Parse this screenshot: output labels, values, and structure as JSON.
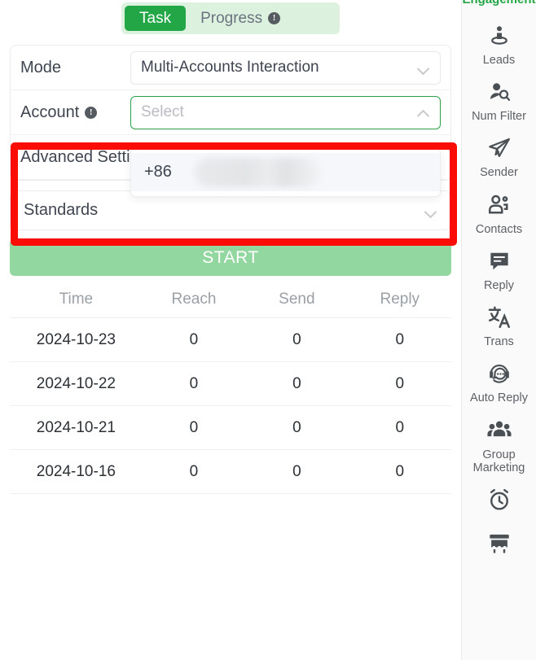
{
  "tabs": [
    {
      "label": "Task",
      "active": true,
      "badge": ""
    },
    {
      "label": "Progress",
      "active": false,
      "badge": "!"
    }
  ],
  "form": {
    "mode": {
      "label": "Mode",
      "value": "Multi-Accounts Interaction",
      "chevron": "chevron-down"
    },
    "account": {
      "label": "Account",
      "badge": "!",
      "placeholder": "Select",
      "chevron": "chevron-up",
      "options": [
        {
          "prefix": "+86",
          "masked": true
        }
      ]
    },
    "advanced": {
      "label": "Advanced Settings"
    }
  },
  "standards": {
    "value": "Standards",
    "chevron": "chevron-down"
  },
  "start_button": {
    "label": "START"
  },
  "table": {
    "columns": [
      "Time",
      "Reach",
      "Send",
      "Reply"
    ],
    "rows": [
      {
        "time": "2024-10-23",
        "reach": "0",
        "send": "0",
        "reply": "0"
      },
      {
        "time": "2024-10-22",
        "reach": "0",
        "send": "0",
        "reply": "0"
      },
      {
        "time": "2024-10-21",
        "reach": "0",
        "send": "0",
        "reply": "0"
      },
      {
        "time": "2024-10-16",
        "reach": "0",
        "send": "0",
        "reply": "0"
      }
    ]
  },
  "sidebar": {
    "heading": "Engagement",
    "items": [
      {
        "label": "Leads",
        "icon": "person-pin-icon"
      },
      {
        "label": "Num Filter",
        "icon": "person-search-icon"
      },
      {
        "label": "Sender",
        "icon": "paper-plane-icon"
      },
      {
        "label": "Contacts",
        "icon": "contacts-icon"
      },
      {
        "label": "Reply",
        "icon": "chat-lines-icon"
      },
      {
        "label": "Trans",
        "icon": "translate-icon"
      },
      {
        "label": "Auto Reply",
        "icon": "headset-chat-icon"
      },
      {
        "label": "Group Marketing",
        "icon": "group-people-icon"
      },
      {
        "label": "",
        "icon": "alarm-clock-icon"
      },
      {
        "label": "",
        "icon": "shop-icon"
      }
    ]
  },
  "colors": {
    "accent_green": "#23a646",
    "tabbar_bg": "#ddf2de",
    "start_button_bg": "#92d6a0",
    "highlight_red": "#fb0d06",
    "sidebar_bg": "#fafafa",
    "badge_gray": "#555b61"
  }
}
